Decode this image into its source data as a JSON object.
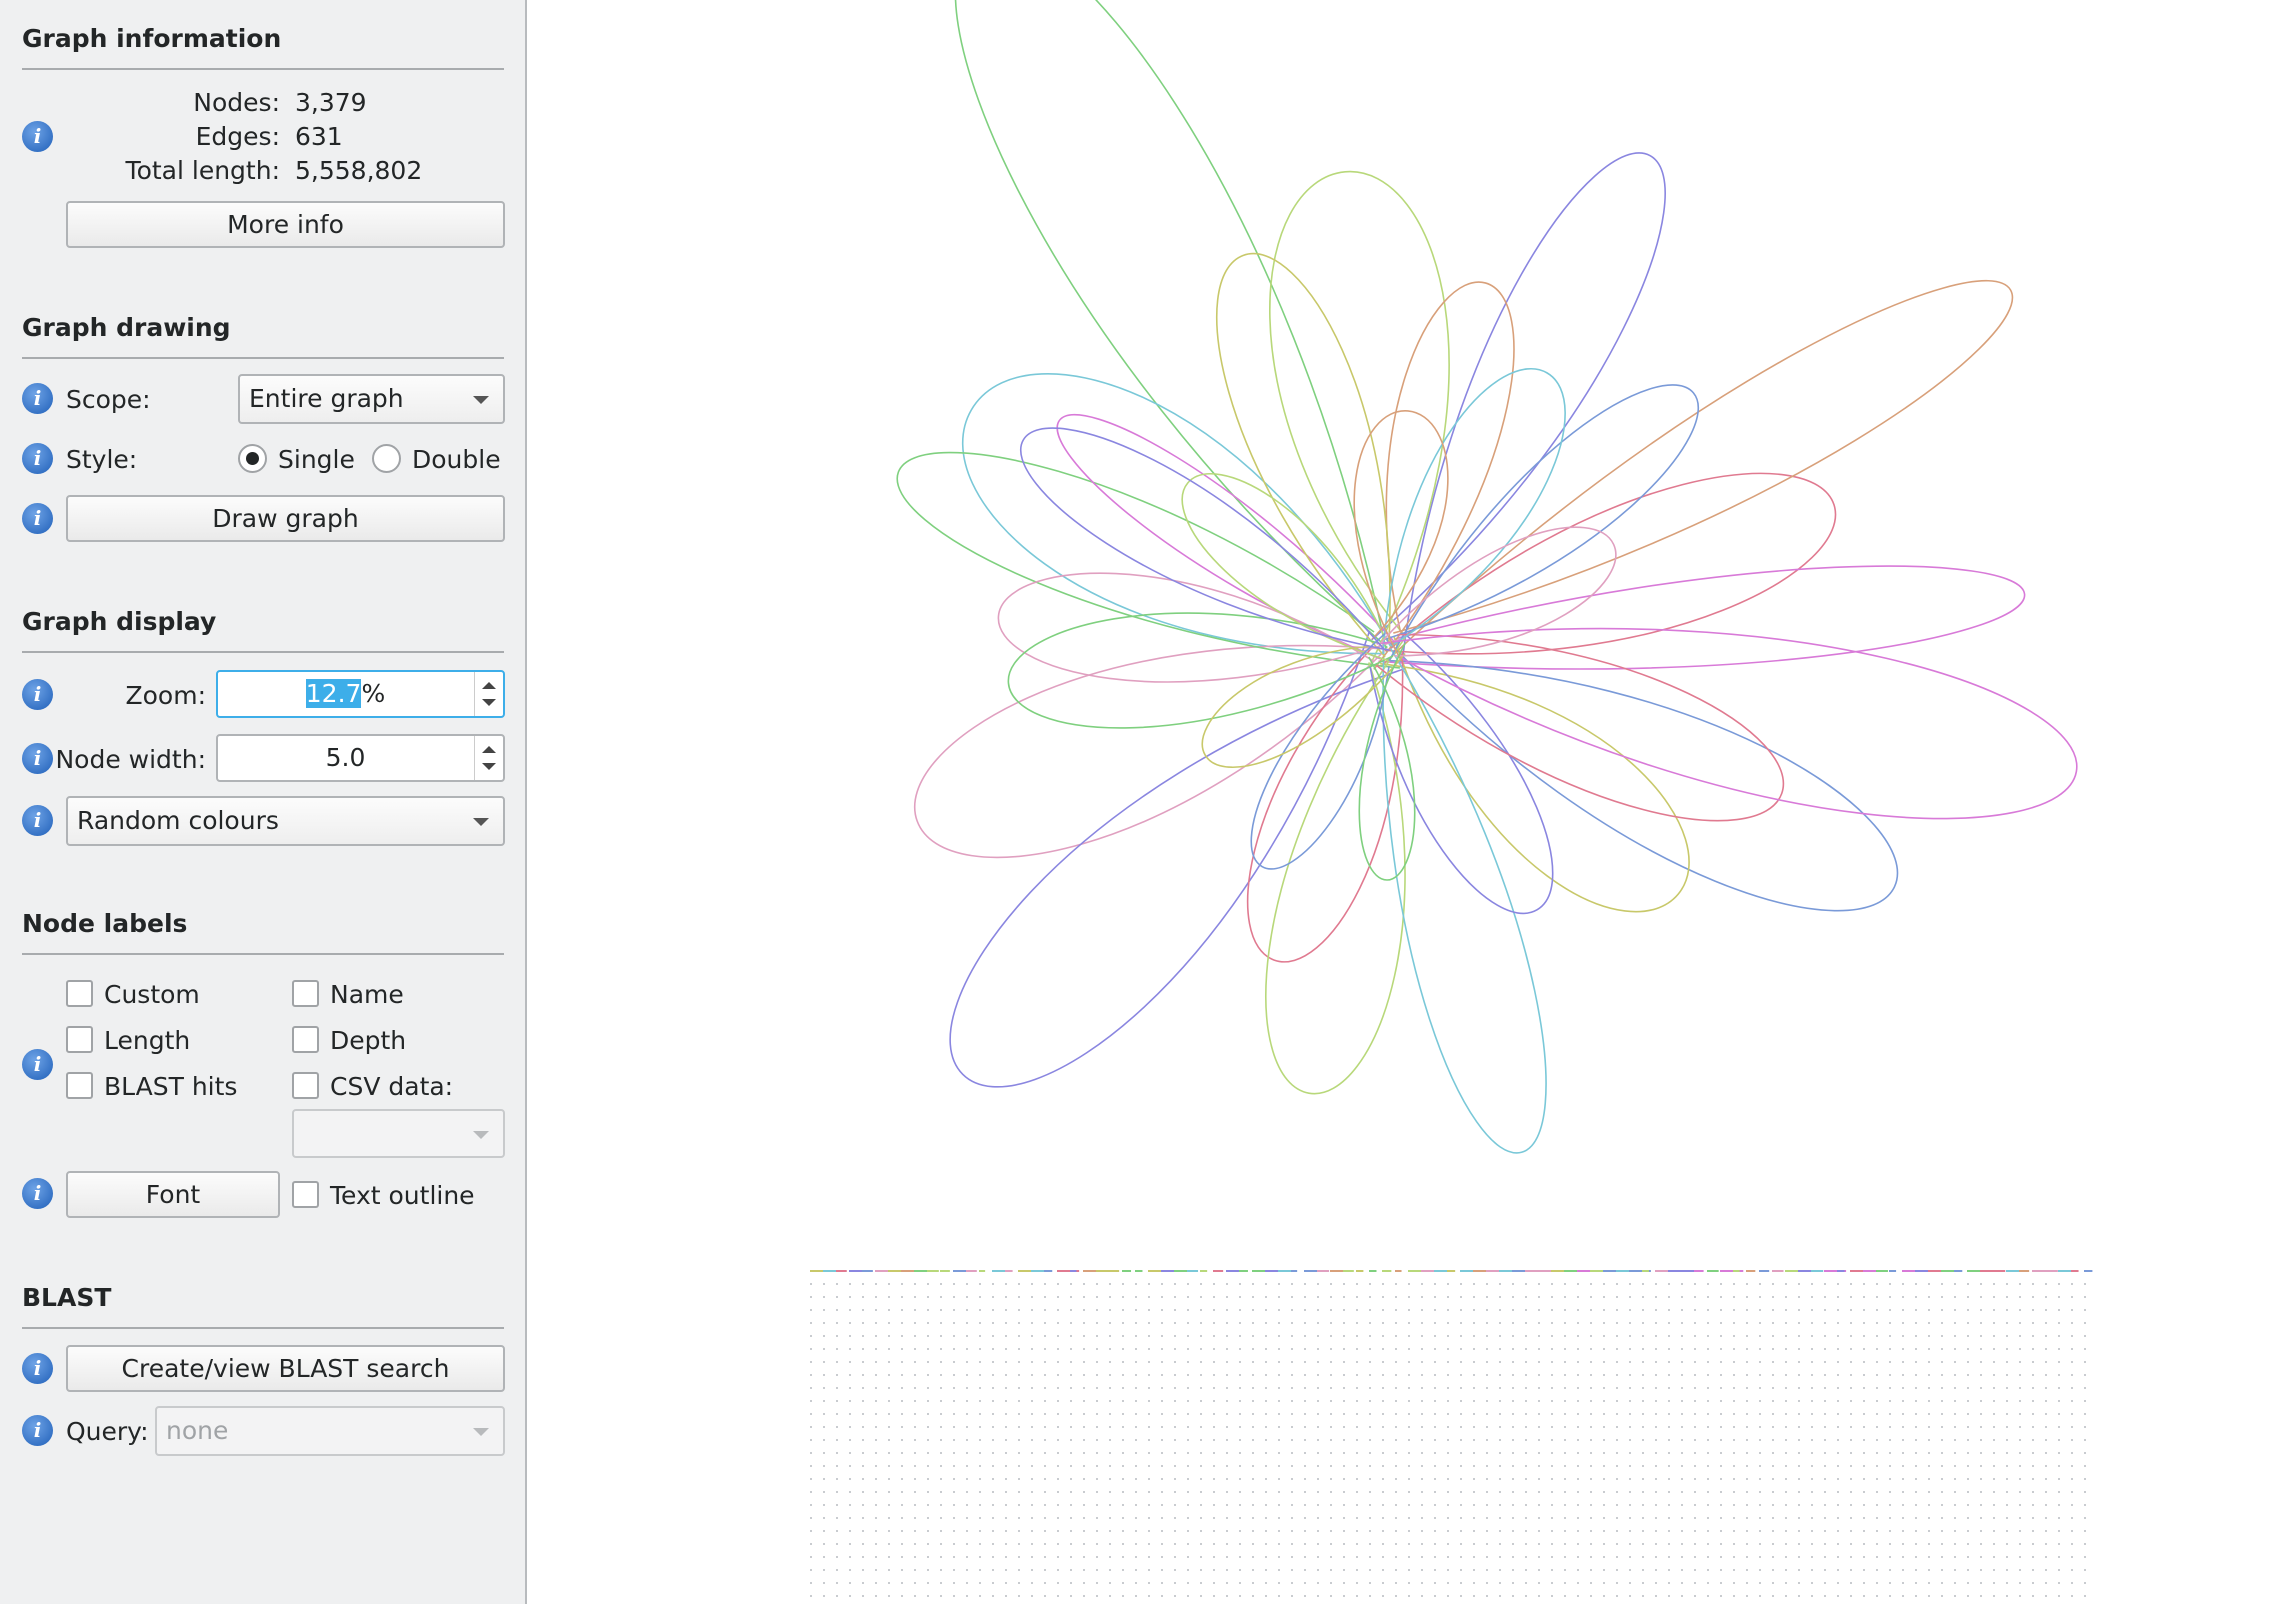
{
  "graph_information": {
    "title": "Graph information",
    "nodes_label": "Nodes:",
    "nodes_value": "3,379",
    "edges_label": "Edges:",
    "edges_value": "631",
    "length_label": "Total length:",
    "length_value": "5,558,802",
    "more_info_label": "More info"
  },
  "graph_drawing": {
    "title": "Graph drawing",
    "scope_label": "Scope:",
    "scope_value": "Entire graph",
    "style_label": "Style:",
    "style_single": "Single",
    "style_double": "Double",
    "style_selected": "Single",
    "draw_label": "Draw graph"
  },
  "graph_display": {
    "title": "Graph display",
    "zoom_label": "Zoom:",
    "zoom_value": "12.7",
    "zoom_suffix": "%",
    "node_width_label": "Node width:",
    "node_width_value": "5.0",
    "colour_value": "Random colours"
  },
  "node_labels": {
    "title": "Node labels",
    "custom": "Custom",
    "name": "Name",
    "length": "Length",
    "depth": "Depth",
    "blast_hits": "BLAST hits",
    "csv_data": "CSV data:",
    "font_label": "Font",
    "text_outline": "Text outline"
  },
  "blast": {
    "title": "BLAST",
    "create_label": "Create/view BLAST search",
    "query_label": "Query:",
    "query_value": "none"
  },
  "icons": {
    "info": "info-icon",
    "dropdown": "chevron-down-icon"
  },
  "colors": {
    "sidebar_bg": "#eff0f1",
    "selection": "#3daee9",
    "info_blue": "#1f5fb8",
    "node_palette": [
      "#7fd07f",
      "#8a86e0",
      "#e07a90",
      "#b8d87a",
      "#7ac8d8",
      "#d87ad8",
      "#d8a07a",
      "#7a9ad8",
      "#c8c86a",
      "#e0a0c0"
    ]
  }
}
